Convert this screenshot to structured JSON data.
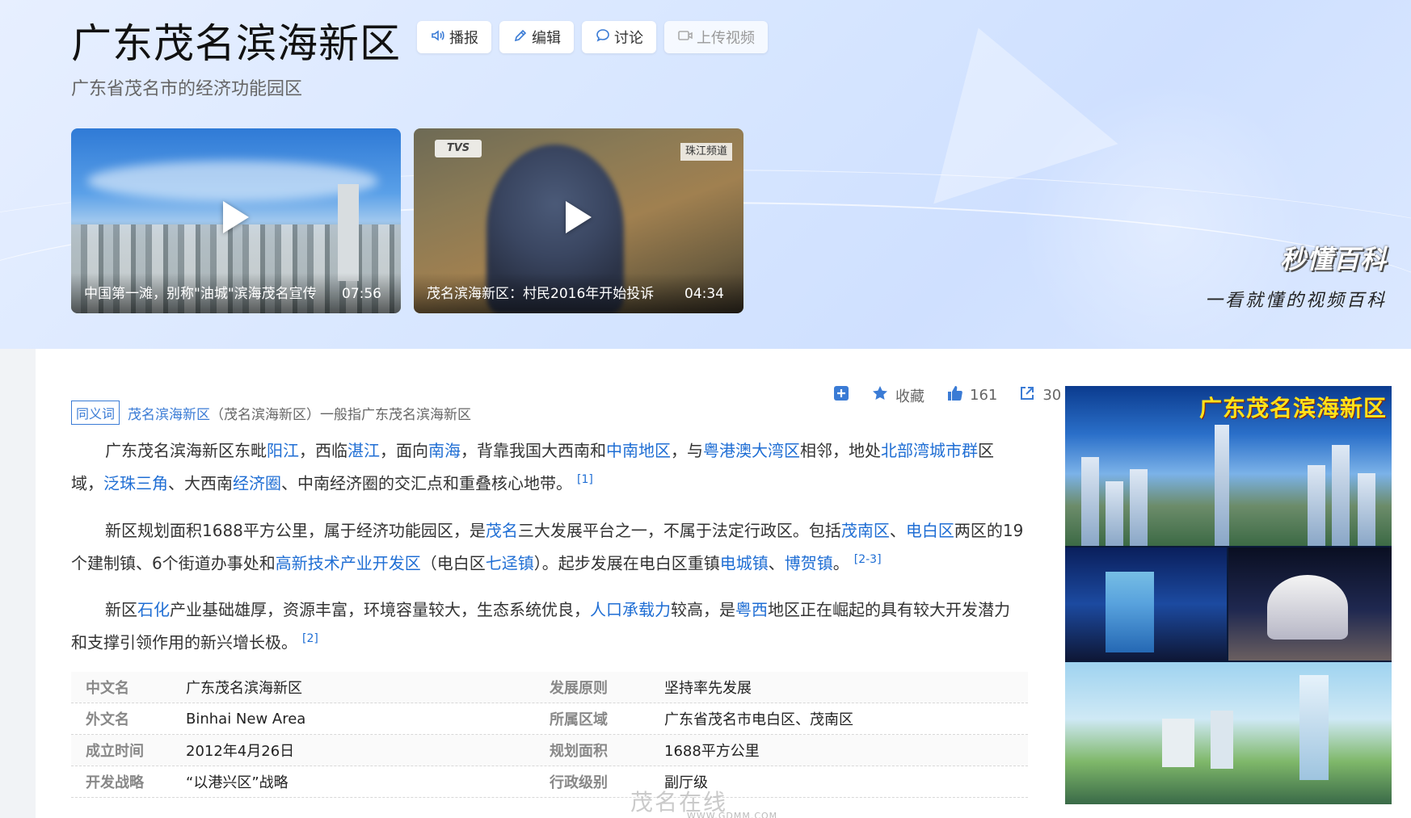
{
  "header": {
    "title": "广东茂名滨海新区",
    "subtitle": "广东省茂名市的经济功能园区",
    "actions": [
      {
        "label": "播报",
        "icon": "speaker-icon"
      },
      {
        "label": "编辑",
        "icon": "pencil-icon"
      },
      {
        "label": "讨论",
        "icon": "chat-bubble-icon"
      },
      {
        "label": "上传视频",
        "icon": "video-upload-icon"
      }
    ]
  },
  "videos": [
    {
      "title": "中国第一滩，别称\"油城\"滨海茂名宣传",
      "duration": "07:56"
    },
    {
      "title": "茂名滨海新区：村民2016年开始投诉",
      "duration": "04:34",
      "logo_text": "TVS",
      "channel_text": "珠江频道"
    }
  ],
  "brand": {
    "logo": "秒懂百科",
    "slogan": "一看就懂的视频百科"
  },
  "toolbar": {
    "add_label": "",
    "favorite_label": "收藏",
    "like_count": "161",
    "share_count": "30"
  },
  "synonym": {
    "tag": "同义词",
    "link": "茂名滨海新区",
    "rest": "（茂名滨海新区）一般指广东茂名滨海新区"
  },
  "summary": {
    "p1": {
      "t1": "广东茂名滨海新区东毗",
      "l1": "阳江",
      "t2": "，西临",
      "l2": "湛江",
      "t3": "，面向",
      "l3": "南海",
      "t4": "，背靠我国大西南和",
      "l4": "中南地区",
      "t5": "，与",
      "l5": "粤港澳大湾区",
      "t6": "相邻，地处",
      "l6": "北部湾城市群",
      "t7": "区域，",
      "l7": "泛珠三角",
      "t8": "、大西南",
      "l8": "经济圈",
      "t9": "、中南经济圈的交汇点和重叠核心地带。",
      "ref": "[1]"
    },
    "p2": {
      "t1": "新区规划面积1688平方公里，属于经济功能园区，是",
      "l1": "茂名",
      "t2": "三大发展平台之一，不属于法定行政区。包括",
      "l2": "茂南区",
      "t3": "、",
      "l3": "电白区",
      "t4": "两区的19个建制镇、6个街道办事处和",
      "l4": "高新技术产业开发区",
      "t5": "（电白区",
      "l5": "七迳镇",
      "t6": "）。起步发展在电白区重镇",
      "l6": "电城镇",
      "t7": "、",
      "l7": "博贺镇",
      "t8": "。",
      "ref": "[2-3]"
    },
    "p3": {
      "t1": "新区",
      "l1": "石化",
      "t2": "产业基础雄厚，资源丰富，环境容量较大，生态系统优良，",
      "l2": "人口承载力",
      "t3": "较高，是",
      "l3": "粤西",
      "t4": "地区正在崛起的具有较大开发潜力和支撑引领作用的新兴增长极。",
      "ref": "[2]"
    }
  },
  "infobox": [
    {
      "k1": "中文名",
      "v1": "广东茂名滨海新区",
      "k2": "发展原则",
      "v2": "坚持率先发展"
    },
    {
      "k1": "外文名",
      "v1": "Binhai New Area",
      "k2": "所属区域",
      "v2": "广东省茂名市电白区、茂南区"
    },
    {
      "k1": "成立时间",
      "v1": "2012年4月26日",
      "k2": "规划面积",
      "v2": "1688平方公里"
    },
    {
      "k1": "开发战略",
      "v1": "“以港兴区”战略",
      "k2": "行政级别",
      "v2": "副厅级"
    }
  ],
  "poster": {
    "title": "广东茂名滨海新区"
  },
  "watermark": {
    "text": "茂名在线",
    "sub": "WWW.GDMM.COM"
  }
}
